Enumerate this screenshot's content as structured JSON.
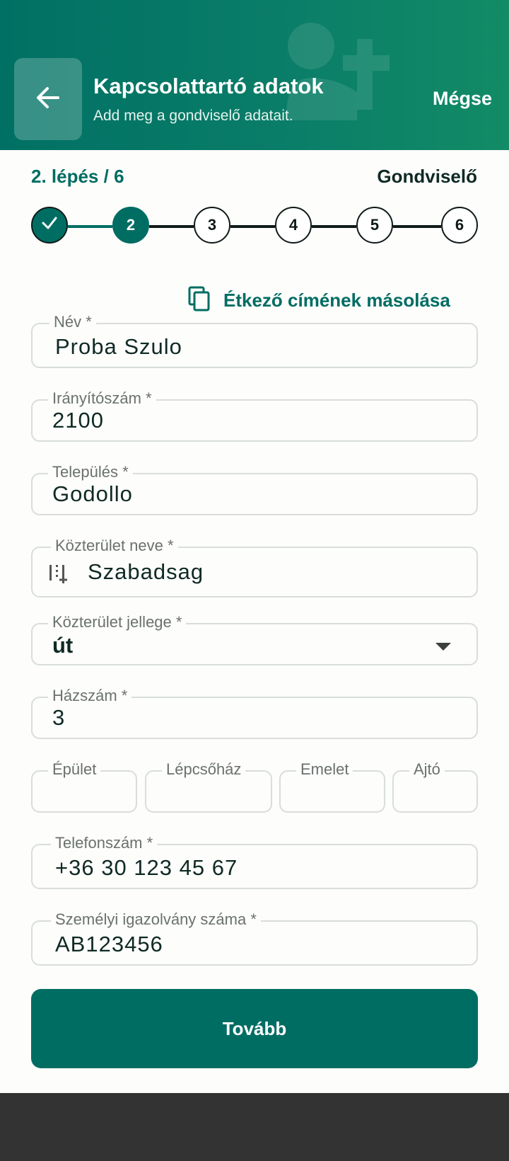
{
  "header": {
    "title": "Kapcsolattartó adatok",
    "subtitle": "Add meg a gondviselő adatait.",
    "cancel_label": "Mégse",
    "back_icon": "arrow-left-icon",
    "decoration_icon": "person-add-icon"
  },
  "step": {
    "label": "2. lépés / 6",
    "name": "Gondviselő",
    "steps": [
      "✓",
      "2",
      "3",
      "4",
      "5",
      "6"
    ],
    "current": 2,
    "total": 6
  },
  "copy_link": {
    "label": "Étkező címének másolása",
    "icon": "copy-icon"
  },
  "fields": {
    "name": {
      "label": "Név *",
      "value": "Proba Szulo"
    },
    "zip": {
      "label": "Irányítószám *",
      "value": "2100"
    },
    "city": {
      "label": "Település *",
      "value": "Godollo"
    },
    "street": {
      "label": "Közterület neve *",
      "value": "Szabadsag",
      "icon": "text-cursor-icon"
    },
    "street_type": {
      "label": "Közterület jellege *",
      "value": "út"
    },
    "house": {
      "label": "Házszám *",
      "value": "3"
    },
    "building": {
      "label": "Épület",
      "value": ""
    },
    "stairs": {
      "label": "Lépcsőház",
      "value": ""
    },
    "floor": {
      "label": "Emelet",
      "value": ""
    },
    "door": {
      "label": "Ajtó",
      "value": ""
    },
    "phone": {
      "label": "Telefonszám *",
      "value": "+36 30 123 45 67"
    },
    "id_card": {
      "label": "Személyi igazolvány száma *",
      "value": "AB123456"
    }
  },
  "next_button": {
    "label": "Tovább"
  },
  "colors": {
    "primary": "#006d63",
    "header_start": "#007064",
    "header_end": "#128b66",
    "bottom_bar": "#333333"
  }
}
